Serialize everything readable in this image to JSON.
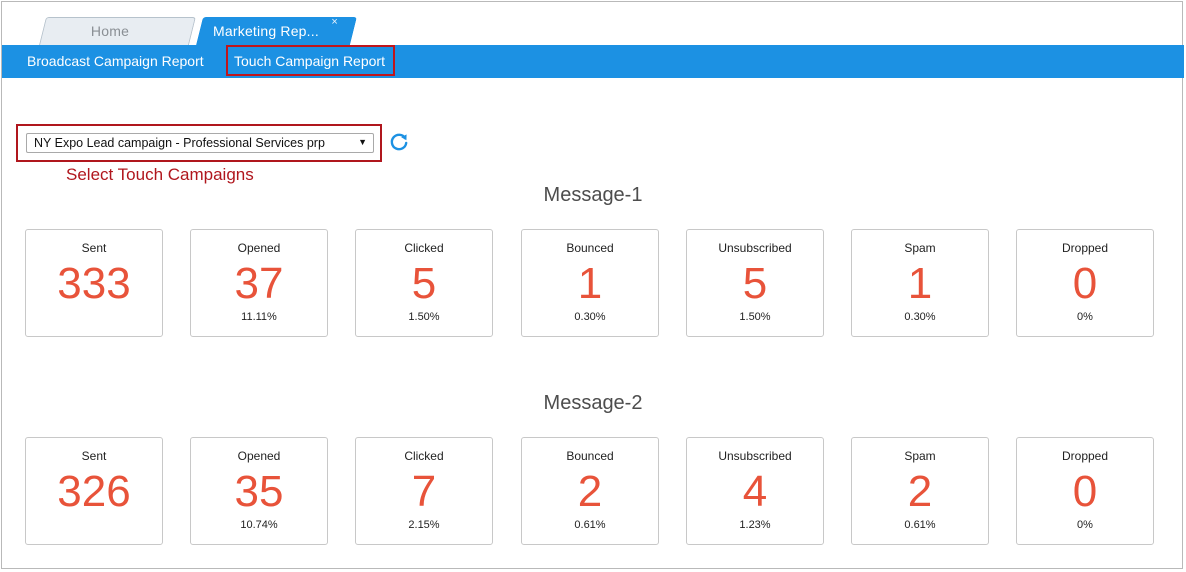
{
  "tabs": [
    {
      "label": "Home"
    },
    {
      "label": "Marketing Rep...",
      "close": "×"
    }
  ],
  "nav": {
    "broadcast": "Broadcast Campaign Report",
    "touch": "Touch Campaign Report"
  },
  "campaign_select": {
    "value": "NY Expo Lead campaign - Professional Services prp",
    "hint": "Select Touch Campaigns"
  },
  "colors": {
    "accent_blue": "#1c91e3",
    "highlight_red": "#b0161d",
    "metric_orange": "#e8533a"
  },
  "messages": [
    {
      "title": "Message-1",
      "stats": [
        {
          "label": "Sent",
          "value": "333",
          "pct": ""
        },
        {
          "label": "Opened",
          "value": "37",
          "pct": "11.11%"
        },
        {
          "label": "Clicked",
          "value": "5",
          "pct": "1.50%"
        },
        {
          "label": "Bounced",
          "value": "1",
          "pct": "0.30%"
        },
        {
          "label": "Unsubscribed",
          "value": "5",
          "pct": "1.50%"
        },
        {
          "label": "Spam",
          "value": "1",
          "pct": "0.30%"
        },
        {
          "label": "Dropped",
          "value": "0",
          "pct": "0%"
        }
      ]
    },
    {
      "title": "Message-2",
      "stats": [
        {
          "label": "Sent",
          "value": "326",
          "pct": ""
        },
        {
          "label": "Opened",
          "value": "35",
          "pct": "10.74%"
        },
        {
          "label": "Clicked",
          "value": "7",
          "pct": "2.15%"
        },
        {
          "label": "Bounced",
          "value": "2",
          "pct": "0.61%"
        },
        {
          "label": "Unsubscribed",
          "value": "4",
          "pct": "1.23%"
        },
        {
          "label": "Spam",
          "value": "2",
          "pct": "0.61%"
        },
        {
          "label": "Dropped",
          "value": "0",
          "pct": "0%"
        }
      ]
    }
  ]
}
